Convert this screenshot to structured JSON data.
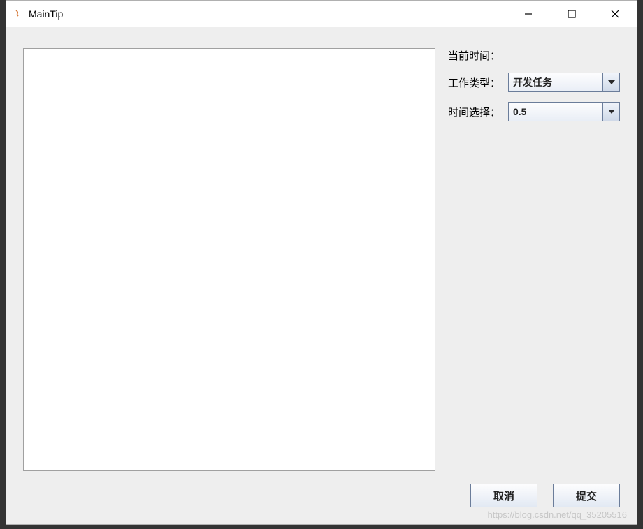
{
  "window": {
    "title": "MainTip"
  },
  "form": {
    "current_time_label": "当前时间：",
    "work_type_label": "工作类型：",
    "work_type_value": "开发任务",
    "time_select_label": "时间选择：",
    "time_select_value": "0.5"
  },
  "buttons": {
    "cancel": "取消",
    "submit": "提交"
  },
  "watermark": "https://blog.csdn.net/qq_35205516"
}
